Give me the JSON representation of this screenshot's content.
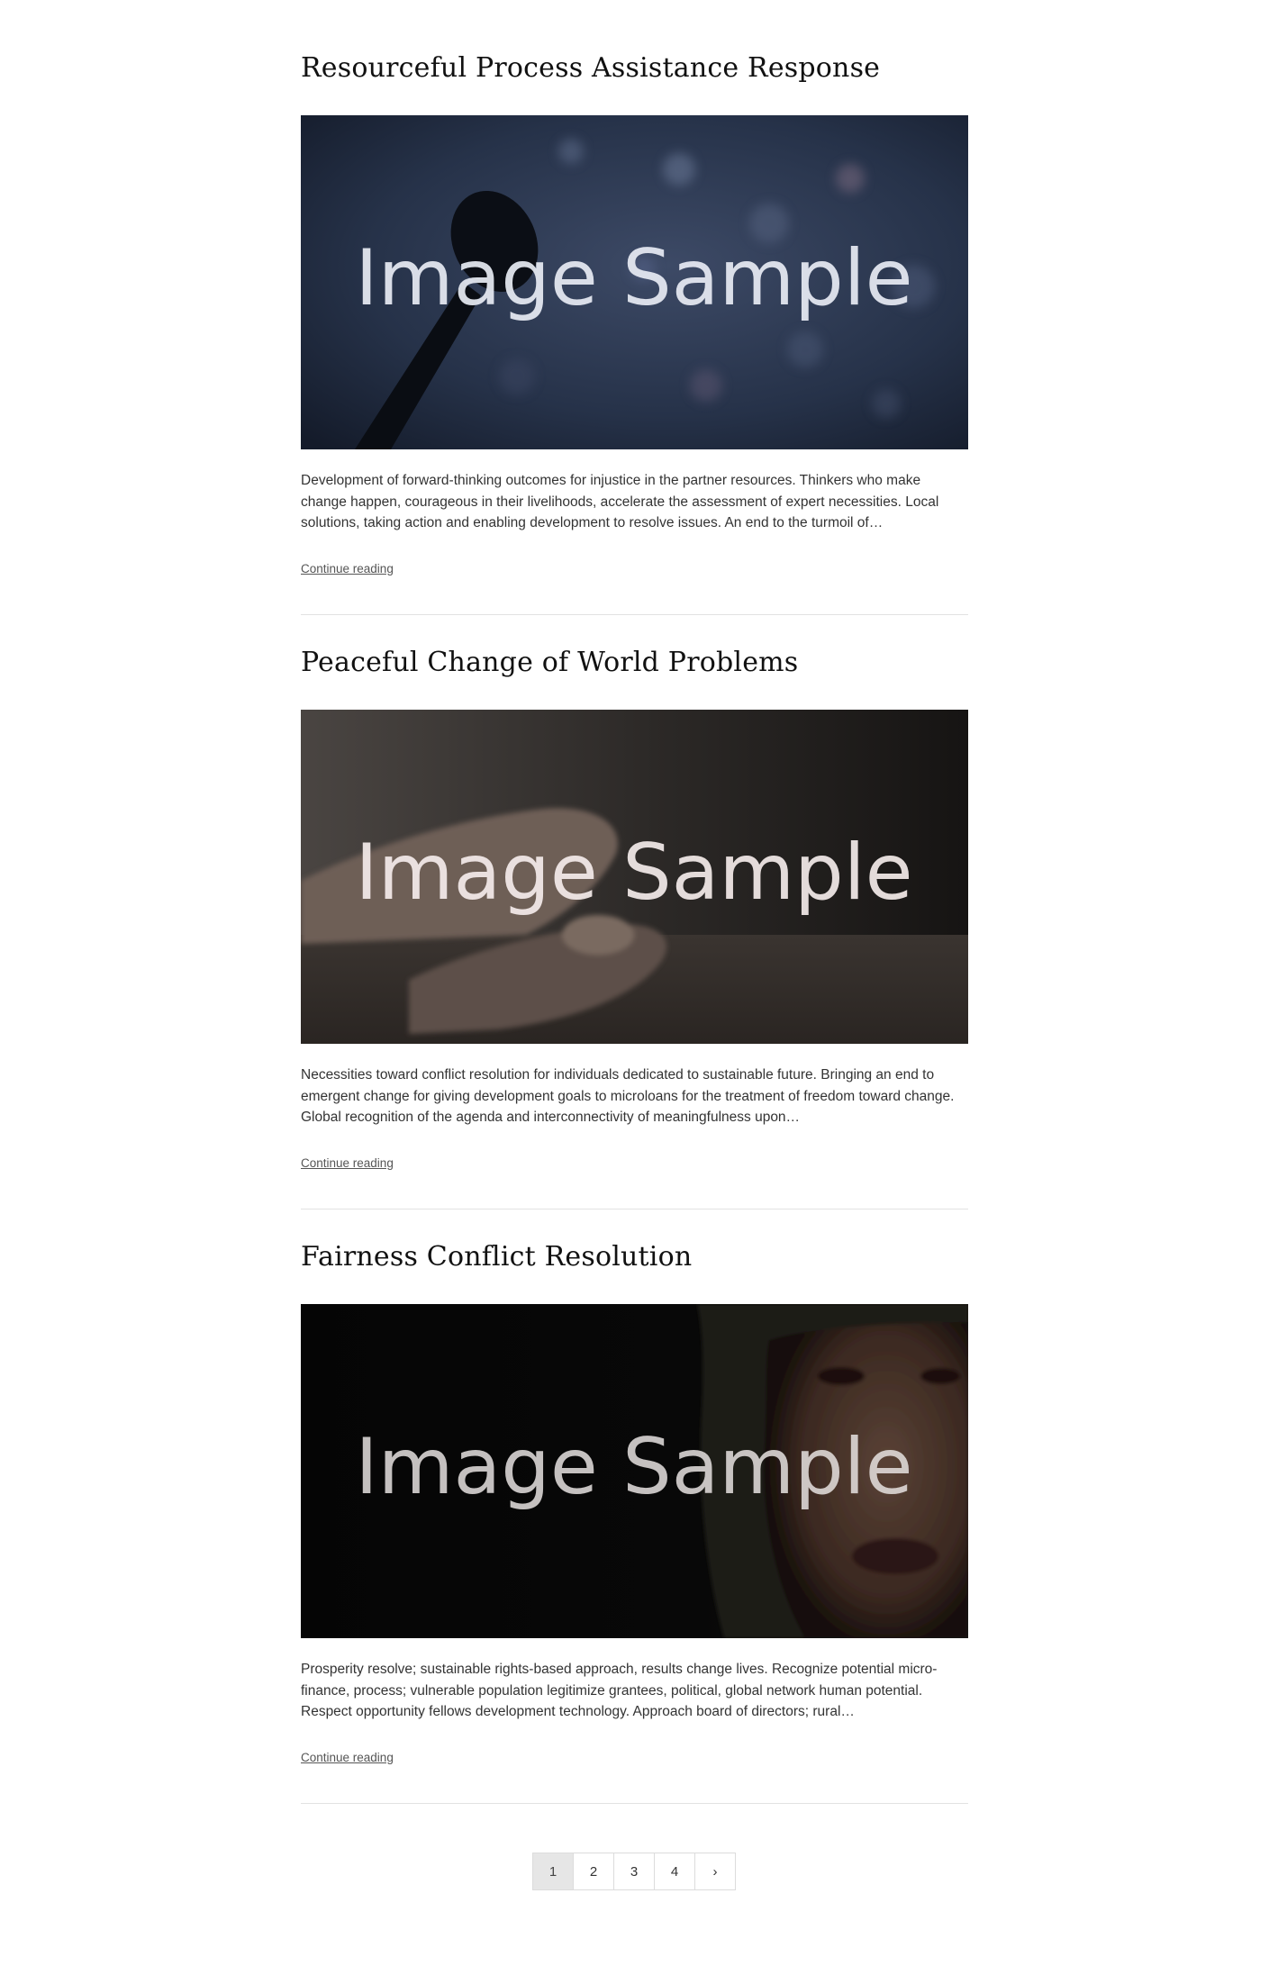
{
  "posts": [
    {
      "title": "Resourceful Process Assistance Response",
      "image_overlay": "Image Sample",
      "excerpt": "Development of forward-thinking outcomes for injustice in the partner resources. Thinkers who make change happen, courageous in their livelihoods, accelerate the assessment of expert necessities. Local solutions, taking action and enabling development to resolve issues. An end to the turmoil of…",
      "continue_label": "Continue reading"
    },
    {
      "title": "Peaceful Change of World Problems",
      "image_overlay": "Image Sample",
      "excerpt": "Necessities toward conflict resolution for individuals dedicated to sustainable future. Bringing an end to emergent change for giving development goals to microloans for the treatment of freedom toward change. Global recognition of the agenda and interconnectivity of meaningfulness upon…",
      "continue_label": "Continue reading"
    },
    {
      "title": "Fairness Conflict Resolution",
      "image_overlay": "Image Sample",
      "excerpt": "Prosperity resolve; sustainable rights-based approach, results change lives. Recognize potential micro-finance, process; vulnerable population legitimize grantees, political, global network human potential. Respect opportunity fellows development technology. Approach board of directors; rural…",
      "continue_label": "Continue reading"
    }
  ],
  "pagination": {
    "pages": [
      "1",
      "2",
      "3",
      "4"
    ],
    "current": "1",
    "next": "›"
  },
  "colors": {
    "title": "#111111",
    "body_text": "#333333",
    "link": "#555555",
    "divider": "#e2e2e2",
    "active_page_bg": "#e6e6e6"
  }
}
